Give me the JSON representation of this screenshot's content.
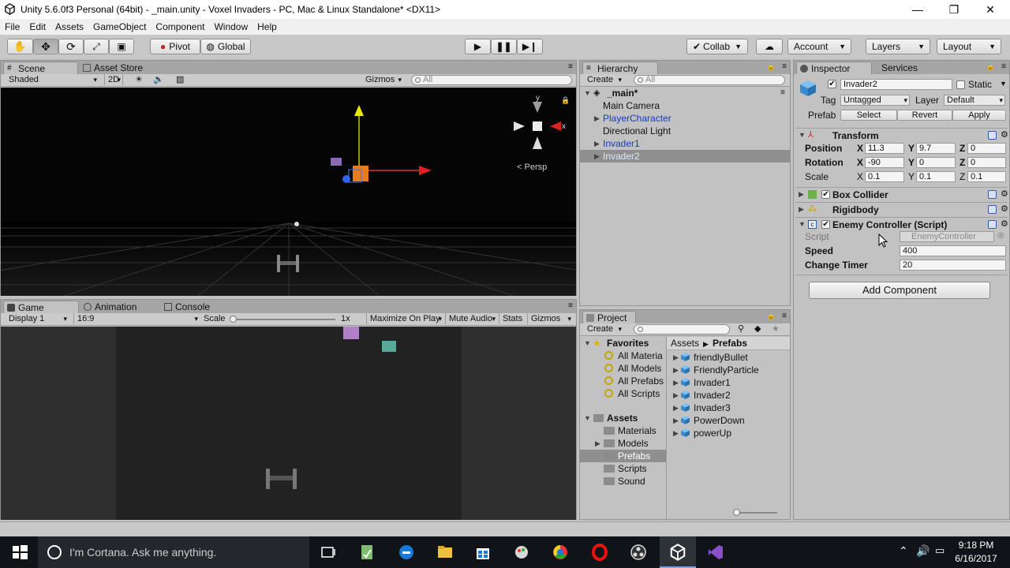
{
  "window": {
    "title": "Unity 5.6.0f3 Personal (64bit) - _main.unity - Voxel Invaders - PC, Mac & Linux Standalone* <DX11>",
    "minimize": "—",
    "maximize": "❐",
    "close": "✕"
  },
  "menu": [
    "File",
    "Edit",
    "Assets",
    "GameObject",
    "Component",
    "Window",
    "Help"
  ],
  "toolbar": {
    "pivot": "Pivot",
    "global": "Global",
    "collab": "Collab",
    "account": "Account",
    "layers": "Layers",
    "layout": "Layout"
  },
  "scene": {
    "tabs": [
      "Scene",
      "Asset Store"
    ],
    "shading": "Shaded",
    "mode2d": "2D",
    "gizmos": "Gizmos",
    "search_placeholder": "All",
    "persp": "Persp",
    "gizmo_y": "y",
    "gizmo_x": "x"
  },
  "game": {
    "tabs": [
      "Game",
      "Animation",
      "Console"
    ],
    "display": "Display 1",
    "aspect": "16:9",
    "scale_label": "Scale",
    "scale_value": "1x",
    "maximize": "Maximize On Play",
    "mute": "Mute Audio",
    "stats": "Stats",
    "gizmos": "Gizmos"
  },
  "hierarchy": {
    "tab": "Hierarchy",
    "create": "Create",
    "search_placeholder": "All",
    "scene": "_main*",
    "items": [
      {
        "label": "Main Camera",
        "arrow": false,
        "prefab": false,
        "selected": false
      },
      {
        "label": "PlayerCharacter",
        "arrow": true,
        "prefab": true,
        "selected": false
      },
      {
        "label": "Directional Light",
        "arrow": false,
        "prefab": false,
        "selected": false
      },
      {
        "label": "Invader1",
        "arrow": true,
        "prefab": true,
        "selected": false
      },
      {
        "label": "Invader2",
        "arrow": true,
        "prefab": true,
        "selected": true
      }
    ]
  },
  "project": {
    "tab": "Project",
    "create": "Create",
    "favorites": "Favorites",
    "fav_items": [
      "All Materia",
      "All Models",
      "All Prefabs",
      "All Scripts"
    ],
    "assets": "Assets",
    "folders": [
      "Materials",
      "Models",
      "Prefabs",
      "Scripts",
      "Sound"
    ],
    "selected_folder": "Prefabs",
    "breadcrumb": [
      "Assets",
      "Prefabs"
    ],
    "files": [
      "friendlyBullet",
      "FriendlyParticle",
      "Invader1",
      "Invader2",
      "Invader3",
      "PowerDown",
      "powerUp"
    ]
  },
  "inspector": {
    "tabs": [
      "Inspector",
      "Services"
    ],
    "object_name": "Invader2",
    "static": "Static",
    "tag_label": "Tag",
    "tag": "Untagged",
    "layer_label": "Layer",
    "layer": "Default",
    "prefab_label": "Prefab",
    "prefab_buttons": [
      "Select",
      "Revert",
      "Apply"
    ],
    "transform": {
      "title": "Transform",
      "position_label": "Position",
      "rotation_label": "Rotation",
      "scale_label": "Scale",
      "position": {
        "x": "11.3",
        "y": "9.7",
        "z": "0"
      },
      "rotation": {
        "x": "-90",
        "y": "0",
        "z": "0"
      },
      "scale": {
        "x": "0.1",
        "y": "0.1",
        "z": "0.1"
      }
    },
    "components": [
      "Box Collider",
      "Rigidbody"
    ],
    "script": {
      "title": "Enemy Controller (Script)",
      "script_label": "Script",
      "script_value": "EnemyController",
      "speed_label": "Speed",
      "speed": "400",
      "timer_label": "Change Timer",
      "timer": "20"
    },
    "add_component": "Add Component"
  },
  "taskbar": {
    "cortana": "I'm Cortana. Ask me anything.",
    "time": "9:18 PM",
    "date": "6/16/2017"
  }
}
